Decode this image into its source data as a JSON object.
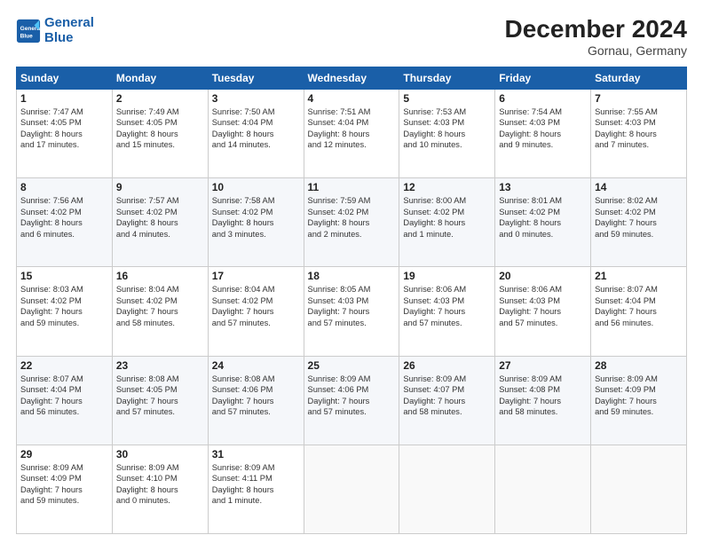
{
  "logo": {
    "line1": "General",
    "line2": "Blue"
  },
  "title": "December 2024",
  "location": "Gornau, Germany",
  "header_days": [
    "Sunday",
    "Monday",
    "Tuesday",
    "Wednesday",
    "Thursday",
    "Friday",
    "Saturday"
  ],
  "weeks": [
    [
      {
        "day": "1",
        "info": "Sunrise: 7:47 AM\nSunset: 4:05 PM\nDaylight: 8 hours\nand 17 minutes."
      },
      {
        "day": "2",
        "info": "Sunrise: 7:49 AM\nSunset: 4:05 PM\nDaylight: 8 hours\nand 15 minutes."
      },
      {
        "day": "3",
        "info": "Sunrise: 7:50 AM\nSunset: 4:04 PM\nDaylight: 8 hours\nand 14 minutes."
      },
      {
        "day": "4",
        "info": "Sunrise: 7:51 AM\nSunset: 4:04 PM\nDaylight: 8 hours\nand 12 minutes."
      },
      {
        "day": "5",
        "info": "Sunrise: 7:53 AM\nSunset: 4:03 PM\nDaylight: 8 hours\nand 10 minutes."
      },
      {
        "day": "6",
        "info": "Sunrise: 7:54 AM\nSunset: 4:03 PM\nDaylight: 8 hours\nand 9 minutes."
      },
      {
        "day": "7",
        "info": "Sunrise: 7:55 AM\nSunset: 4:03 PM\nDaylight: 8 hours\nand 7 minutes."
      }
    ],
    [
      {
        "day": "8",
        "info": "Sunrise: 7:56 AM\nSunset: 4:02 PM\nDaylight: 8 hours\nand 6 minutes."
      },
      {
        "day": "9",
        "info": "Sunrise: 7:57 AM\nSunset: 4:02 PM\nDaylight: 8 hours\nand 4 minutes."
      },
      {
        "day": "10",
        "info": "Sunrise: 7:58 AM\nSunset: 4:02 PM\nDaylight: 8 hours\nand 3 minutes."
      },
      {
        "day": "11",
        "info": "Sunrise: 7:59 AM\nSunset: 4:02 PM\nDaylight: 8 hours\nand 2 minutes."
      },
      {
        "day": "12",
        "info": "Sunrise: 8:00 AM\nSunset: 4:02 PM\nDaylight: 8 hours\nand 1 minute."
      },
      {
        "day": "13",
        "info": "Sunrise: 8:01 AM\nSunset: 4:02 PM\nDaylight: 8 hours\nand 0 minutes."
      },
      {
        "day": "14",
        "info": "Sunrise: 8:02 AM\nSunset: 4:02 PM\nDaylight: 7 hours\nand 59 minutes."
      }
    ],
    [
      {
        "day": "15",
        "info": "Sunrise: 8:03 AM\nSunset: 4:02 PM\nDaylight: 7 hours\nand 59 minutes."
      },
      {
        "day": "16",
        "info": "Sunrise: 8:04 AM\nSunset: 4:02 PM\nDaylight: 7 hours\nand 58 minutes."
      },
      {
        "day": "17",
        "info": "Sunrise: 8:04 AM\nSunset: 4:02 PM\nDaylight: 7 hours\nand 57 minutes."
      },
      {
        "day": "18",
        "info": "Sunrise: 8:05 AM\nSunset: 4:03 PM\nDaylight: 7 hours\nand 57 minutes."
      },
      {
        "day": "19",
        "info": "Sunrise: 8:06 AM\nSunset: 4:03 PM\nDaylight: 7 hours\nand 57 minutes."
      },
      {
        "day": "20",
        "info": "Sunrise: 8:06 AM\nSunset: 4:03 PM\nDaylight: 7 hours\nand 57 minutes."
      },
      {
        "day": "21",
        "info": "Sunrise: 8:07 AM\nSunset: 4:04 PM\nDaylight: 7 hours\nand 56 minutes."
      }
    ],
    [
      {
        "day": "22",
        "info": "Sunrise: 8:07 AM\nSunset: 4:04 PM\nDaylight: 7 hours\nand 56 minutes."
      },
      {
        "day": "23",
        "info": "Sunrise: 8:08 AM\nSunset: 4:05 PM\nDaylight: 7 hours\nand 57 minutes."
      },
      {
        "day": "24",
        "info": "Sunrise: 8:08 AM\nSunset: 4:06 PM\nDaylight: 7 hours\nand 57 minutes."
      },
      {
        "day": "25",
        "info": "Sunrise: 8:09 AM\nSunset: 4:06 PM\nDaylight: 7 hours\nand 57 minutes."
      },
      {
        "day": "26",
        "info": "Sunrise: 8:09 AM\nSunset: 4:07 PM\nDaylight: 7 hours\nand 58 minutes."
      },
      {
        "day": "27",
        "info": "Sunrise: 8:09 AM\nSunset: 4:08 PM\nDaylight: 7 hours\nand 58 minutes."
      },
      {
        "day": "28",
        "info": "Sunrise: 8:09 AM\nSunset: 4:09 PM\nDaylight: 7 hours\nand 59 minutes."
      }
    ],
    [
      {
        "day": "29",
        "info": "Sunrise: 8:09 AM\nSunset: 4:09 PM\nDaylight: 7 hours\nand 59 minutes."
      },
      {
        "day": "30",
        "info": "Sunrise: 8:09 AM\nSunset: 4:10 PM\nDaylight: 8 hours\nand 0 minutes."
      },
      {
        "day": "31",
        "info": "Sunrise: 8:09 AM\nSunset: 4:11 PM\nDaylight: 8 hours\nand 1 minute."
      },
      null,
      null,
      null,
      null
    ]
  ]
}
